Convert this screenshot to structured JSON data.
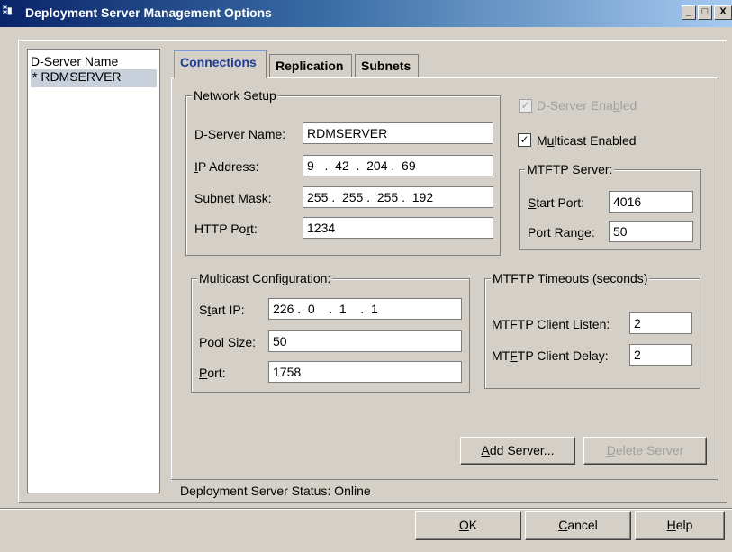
{
  "window": {
    "title": "Deployment Server Management Options",
    "controls": {
      "minimize": "_",
      "maximize": "□",
      "close": "X"
    }
  },
  "server_list": {
    "header": "D-Server Name",
    "items": [
      "* RDMSERVER"
    ]
  },
  "tabs": [
    {
      "label": "Connections",
      "active": true
    },
    {
      "label": "Replication",
      "active": false
    },
    {
      "label": "Subnets",
      "active": false
    }
  ],
  "network_setup": {
    "title": "Network Setup",
    "dserver_name_label": "D-Server Name:",
    "dserver_name_value": "RDMSERVER",
    "ip_label": "IP Address:",
    "ip_value": "9   .  42  .  204 .  69",
    "subnet_label": "Subnet Mask:",
    "subnet_value": "255 .  255 .  255 .  192",
    "http_port_label": "HTTP Port:",
    "http_port_value": "1234"
  },
  "options": {
    "dserver_enabled_label": "D-Server Enabled",
    "dserver_enabled_checked": true,
    "multicast_enabled_label": "Multicast Enabled",
    "multicast_enabled_checked": true
  },
  "mtftp_server": {
    "title": "MTFTP Server:",
    "start_port_label": "Start Port:",
    "start_port_value": "4016",
    "port_range_label": "Port Range:",
    "port_range_value": "50"
  },
  "multicast_config": {
    "title": "Multicast Configuration:",
    "start_ip_label": "Start IP:",
    "start_ip_value": "226 .  0    .  1    .  1",
    "pool_size_label": "Pool Size:",
    "pool_size_value": "50",
    "port_label": "Port:",
    "port_value": "1758"
  },
  "mtftp_timeouts": {
    "title": "MTFTP Timeouts (seconds)",
    "client_listen_label": "MTFTP Client Listen:",
    "client_listen_value": "2",
    "client_delay_label": "MTFTP Client Delay:",
    "client_delay_value": "2"
  },
  "buttons": {
    "add_server": "Add Server...",
    "delete_server": "Delete Server",
    "ok": "OK",
    "cancel": "Cancel",
    "help": "Help"
  },
  "status": "Deployment Server Status: Online"
}
